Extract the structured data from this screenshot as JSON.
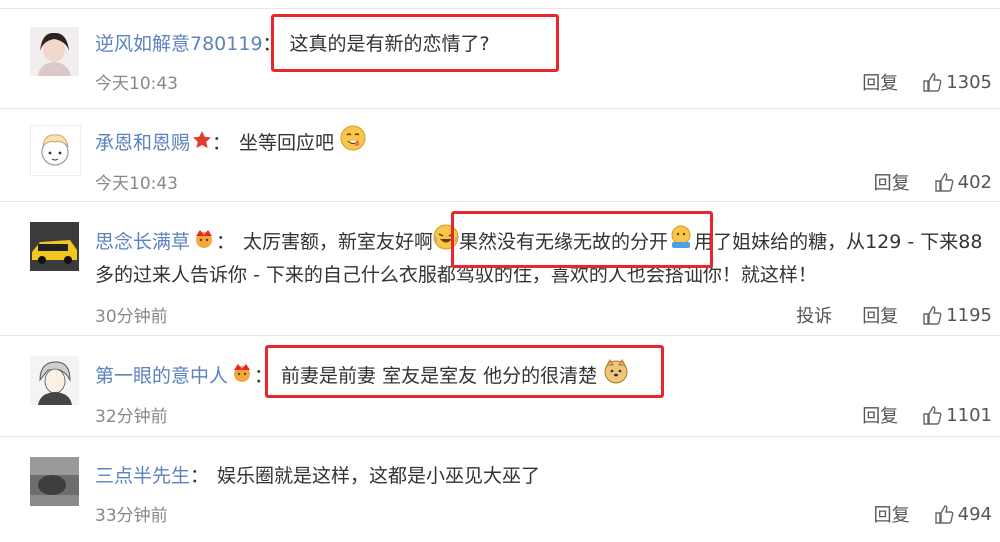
{
  "comments": [
    {
      "username": "逆风如解意780119",
      "colon": "：",
      "text": "这真的是有新的恋情了?",
      "time": "今天10:43",
      "reply_label": "回复",
      "likes": "1305"
    },
    {
      "username": "承恩和恩赐",
      "colon": "：",
      "text": "坐等回应吧",
      "time": "今天10:43",
      "reply_label": "回复",
      "likes": "402"
    },
    {
      "username": "思念长满草",
      "colon": "：",
      "text_a": "太厉害额，新室友好啊",
      "text_b": "果然没有无缘无故的分开",
      "text_c": "用了姐妹给的糖，从129 - 下来88",
      "text_d": "多的过来人告诉你  - 下来的自己什么衣服都驾驭的住，喜欢的人也会搭讪你！就这样！",
      "time": "30分钟前",
      "report_label": "投诉",
      "reply_label": "回复",
      "likes": "1195"
    },
    {
      "username": "第一眼的意中人",
      "colon": "：",
      "text": "前妻是前妻 室友是室友 他分的很清楚",
      "time": "32分钟前",
      "reply_label": "回复",
      "likes": "1101"
    },
    {
      "username": "三点半先生",
      "colon": "：",
      "text": "娱乐圈就是这样，这都是小巫见大巫了",
      "time": "33分钟前",
      "reply_label": "回复",
      "likes": "494"
    }
  ],
  "colors": {
    "username": "#5d82bf",
    "highlight": "#e8262b",
    "time": "#888888",
    "divider": "#e6e6e6"
  }
}
